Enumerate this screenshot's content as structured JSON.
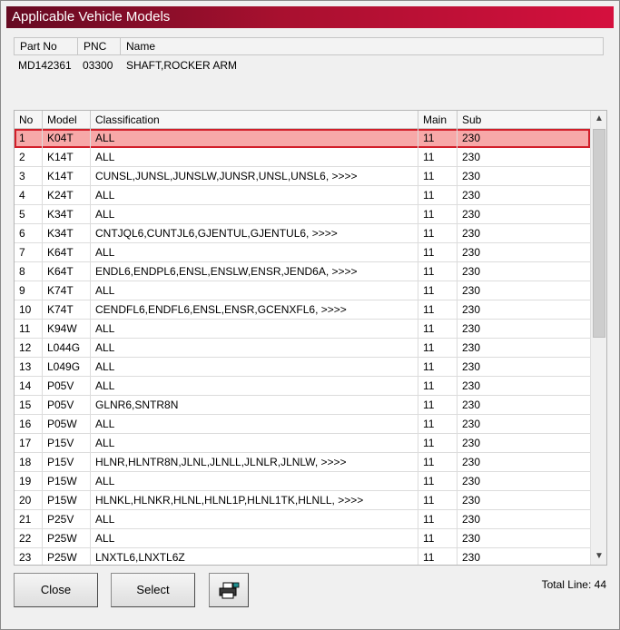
{
  "window": {
    "title": "Applicable Vehicle Models"
  },
  "part": {
    "headers": [
      "Part No",
      "PNC",
      "Name"
    ],
    "part_no": "MD142361",
    "pnc": "03300",
    "name": "SHAFT,ROCKER ARM"
  },
  "table": {
    "headers": [
      "No",
      "Model",
      "Classification",
      "Main",
      "Sub"
    ],
    "selected_index": 0,
    "rows": [
      {
        "no": "1",
        "model": "K04T",
        "classification": "ALL",
        "main": "11",
        "sub": "230"
      },
      {
        "no": "2",
        "model": "K14T",
        "classification": "ALL",
        "main": "11",
        "sub": "230"
      },
      {
        "no": "3",
        "model": "K14T",
        "classification": "CUNSL,JUNSL,JUNSLW,JUNSR,UNSL,UNSL6,  >>>>",
        "main": "11",
        "sub": "230"
      },
      {
        "no": "4",
        "model": "K24T",
        "classification": "ALL",
        "main": "11",
        "sub": "230"
      },
      {
        "no": "5",
        "model": "K34T",
        "classification": "ALL",
        "main": "11",
        "sub": "230"
      },
      {
        "no": "6",
        "model": "K34T",
        "classification": "CNTJQL6,CUNTJL6,GJENTUL,GJENTUL6,  >>>>",
        "main": "11",
        "sub": "230"
      },
      {
        "no": "7",
        "model": "K64T",
        "classification": "ALL",
        "main": "11",
        "sub": "230"
      },
      {
        "no": "8",
        "model": "K64T",
        "classification": "ENDL6,ENDPL6,ENSL,ENSLW,ENSR,JEND6A,  >>>>",
        "main": "11",
        "sub": "230"
      },
      {
        "no": "9",
        "model": "K74T",
        "classification": "ALL",
        "main": "11",
        "sub": "230"
      },
      {
        "no": "10",
        "model": "K74T",
        "classification": "CENDFL6,ENDFL6,ENSL,ENSR,GCENXFL6,  >>>>",
        "main": "11",
        "sub": "230"
      },
      {
        "no": "11",
        "model": "K94W",
        "classification": "ALL",
        "main": "11",
        "sub": "230"
      },
      {
        "no": "12",
        "model": "L044G",
        "classification": "ALL",
        "main": "11",
        "sub": "230"
      },
      {
        "no": "13",
        "model": "L049G",
        "classification": "ALL",
        "main": "11",
        "sub": "230"
      },
      {
        "no": "14",
        "model": "P05V",
        "classification": "ALL",
        "main": "11",
        "sub": "230"
      },
      {
        "no": "15",
        "model": "P05V",
        "classification": "GLNR6,SNTR8N",
        "main": "11",
        "sub": "230"
      },
      {
        "no": "16",
        "model": "P05W",
        "classification": "ALL",
        "main": "11",
        "sub": "230"
      },
      {
        "no": "17",
        "model": "P15V",
        "classification": "ALL",
        "main": "11",
        "sub": "230"
      },
      {
        "no": "18",
        "model": "P15V",
        "classification": "HLNR,HLNTR8N,JLNL,JLNLL,JLNLR,JLNLW,  >>>>",
        "main": "11",
        "sub": "230"
      },
      {
        "no": "19",
        "model": "P15W",
        "classification": "ALL",
        "main": "11",
        "sub": "230"
      },
      {
        "no": "20",
        "model": "P15W",
        "classification": "HLNKL,HLNKR,HLNL,HLNL1P,HLNL1TK,HLNLL,  >>>>",
        "main": "11",
        "sub": "230"
      },
      {
        "no": "21",
        "model": "P25V",
        "classification": "ALL",
        "main": "11",
        "sub": "230"
      },
      {
        "no": "22",
        "model": "P25W",
        "classification": "ALL",
        "main": "11",
        "sub": "230"
      },
      {
        "no": "23",
        "model": "P25W",
        "classification": "LNXTL6,LNXTL6Z",
        "main": "11",
        "sub": "230"
      }
    ]
  },
  "buttons": {
    "close": "Close",
    "select": "Select",
    "print_icon": "printer-icon"
  },
  "footer": {
    "total_line": "Total Line: 44"
  },
  "colors": {
    "title_start": "#650a22",
    "title_end": "#d5103e",
    "selected_row": "#f7a8a8",
    "selected_border": "#d21f2a"
  }
}
